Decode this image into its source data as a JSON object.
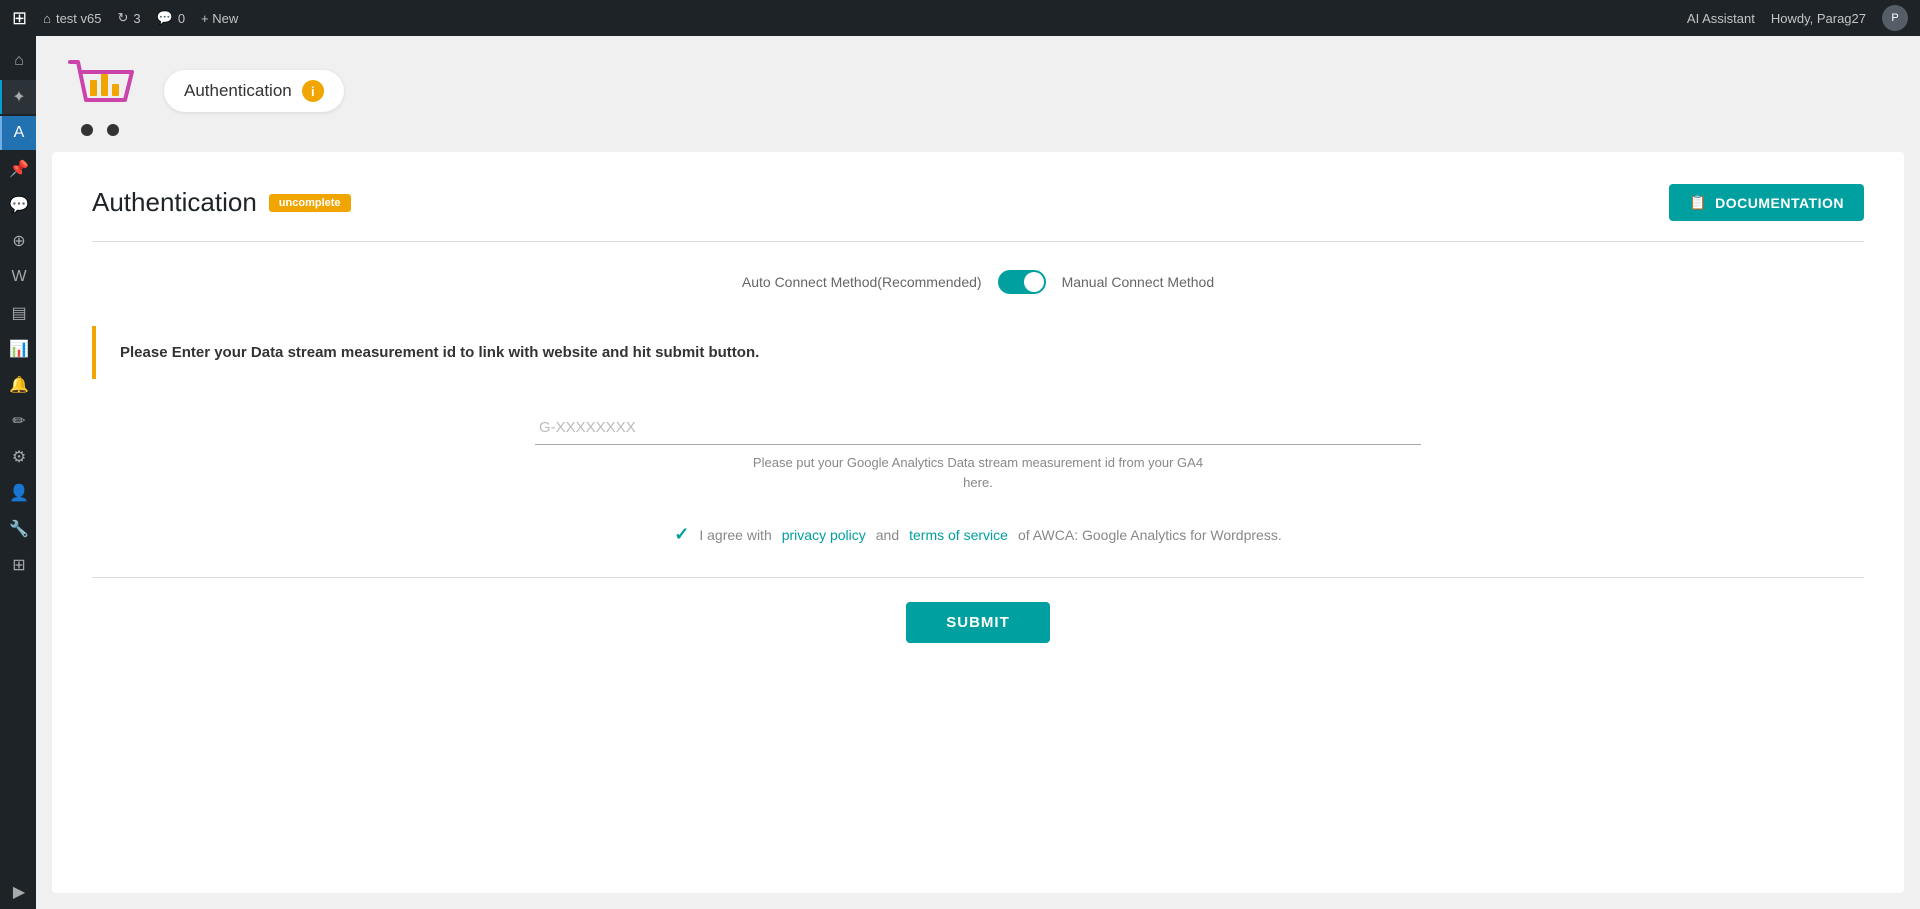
{
  "topbar": {
    "wp_icon": "W",
    "site_name": "test v65",
    "updates_icon": "↻",
    "updates_count": "3",
    "comments_icon": "💬",
    "comments_count": "0",
    "new_label": "+ New",
    "ai_assistant_label": "AI Assistant",
    "howdy_label": "Howdy, Parag27"
  },
  "plugin_header": {
    "bubble_title": "Authentication",
    "info_icon": "i"
  },
  "page": {
    "title": "Authentication",
    "badge": "uncomplete",
    "doc_button_label": "DOCUMENTATION",
    "doc_icon": "📋"
  },
  "toggle": {
    "left_label": "Auto Connect Method(Recommended)",
    "right_label": "Manual Connect Method"
  },
  "info_box": {
    "message": "Please Enter your Data stream measurement id to link with website and hit submit button."
  },
  "input": {
    "placeholder": "G-XXXXXXXX",
    "hint_line1": "Please put your Google Analytics Data stream measurement id from your GA4",
    "hint_line2": "here."
  },
  "agreement": {
    "text_before": "I agree with ",
    "privacy_policy_label": "privacy policy",
    "text_and": " and ",
    "terms_label": "terms of service",
    "text_after": "of AWCA: Google Analytics for Wordpress."
  },
  "submit": {
    "label": "SUBMIT"
  },
  "sidebar": {
    "items": [
      {
        "icon": "⌂",
        "name": "dashboard"
      },
      {
        "icon": "✦",
        "name": "analytics"
      },
      {
        "icon": "A",
        "name": "analytics-plugin"
      },
      {
        "icon": "📌",
        "name": "pin"
      },
      {
        "icon": "💬",
        "name": "comments"
      },
      {
        "icon": "⊕",
        "name": "jetpack"
      },
      {
        "icon": "W",
        "name": "woo"
      },
      {
        "icon": "▤",
        "name": "pages"
      },
      {
        "icon": "📊",
        "name": "stats"
      },
      {
        "icon": "🔔",
        "name": "notifications"
      },
      {
        "icon": "✏",
        "name": "tools"
      },
      {
        "icon": "⚙",
        "name": "settings"
      },
      {
        "icon": "👤",
        "name": "users"
      },
      {
        "icon": "🔧",
        "name": "wrench"
      },
      {
        "icon": "⊞",
        "name": "plugins"
      },
      {
        "icon": "▶",
        "name": "play"
      }
    ]
  }
}
